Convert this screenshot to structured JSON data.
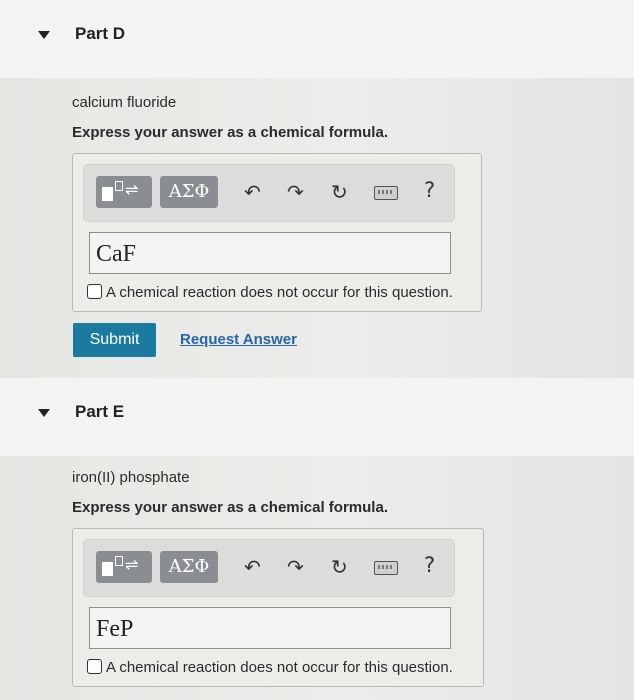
{
  "part_d": {
    "title": "Part D",
    "compound": "calcium fluoride",
    "instruction": "Express your answer as a chemical formula.",
    "toolbar": {
      "greek_label": "ΑΣΦ",
      "help": "?"
    },
    "answer_value": "CaF",
    "no_reaction_label": "A chemical reaction does not occur for this question.",
    "submit_label": "Submit",
    "request_label": "Request Answer"
  },
  "part_e": {
    "title": "Part E",
    "compound": "iron(II) phosphate",
    "instruction": "Express your answer as a chemical formula.",
    "toolbar": {
      "greek_label": "ΑΣΦ",
      "help": "?"
    },
    "answer_value": "FeP",
    "no_reaction_label": "A chemical reaction does not occur for this question."
  },
  "colors": {
    "submit_bg": "#1a7aa0",
    "link": "#2466a8",
    "tool_button": "#8a8d91"
  },
  "icons": [
    "collapse-triangle-icon",
    "templates-icon",
    "undo-icon",
    "redo-icon",
    "reset-icon",
    "keyboard-icon",
    "help-icon"
  ]
}
